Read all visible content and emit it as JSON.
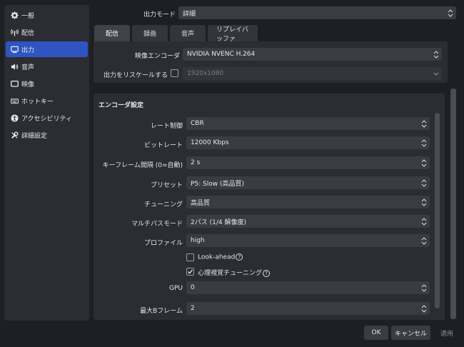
{
  "sidebar": {
    "items": [
      {
        "label": "一般",
        "icon": "gear-icon"
      },
      {
        "label": "配信",
        "icon": "antenna-icon"
      },
      {
        "label": "出力",
        "icon": "monitor-output-icon",
        "active": true
      },
      {
        "label": "音声",
        "icon": "speaker-icon"
      },
      {
        "label": "映像",
        "icon": "display-icon"
      },
      {
        "label": "ホットキー",
        "icon": "keyboard-icon"
      },
      {
        "label": "アクセシビリティ",
        "icon": "accessibility-icon"
      },
      {
        "label": "詳細設定",
        "icon": "wrench-icon"
      }
    ]
  },
  "output_mode": {
    "label": "出力モード",
    "value": "詳細"
  },
  "tabs": [
    "配信",
    "録画",
    "音声",
    "リプレイバッファ"
  ],
  "encoder": {
    "label": "映像エンコーダ",
    "value": "NVIDIA NVENC H.264"
  },
  "rescale": {
    "label": "出力をリスケールする",
    "value": "1920x1080"
  },
  "encoder_settings": {
    "title": "エンコーダ設定",
    "rate_control": {
      "label": "レート制御",
      "value": "CBR"
    },
    "bitrate": {
      "label": "ビットレート",
      "value": "12000 Kbps"
    },
    "keyframe": {
      "label": "キーフレーム間隔 (0=自動)",
      "value": "2 s"
    },
    "preset": {
      "label": "プリセット",
      "value": "P5: Slow (高品質)"
    },
    "tuning": {
      "label": "チューニング",
      "value": "高品質"
    },
    "multipass": {
      "label": "マルチパスモード",
      "value": "2パス (1/4 解像度)"
    },
    "profile": {
      "label": "プロファイル",
      "value": "high"
    },
    "lookahead": {
      "label": "Look-ahead",
      "checked": false
    },
    "psycho": {
      "label": "心理視覚チューニング",
      "checked": true
    },
    "gpu": {
      "label": "GPU",
      "value": "0"
    },
    "bframes": {
      "label": "最大Bフレーム",
      "value": "2"
    }
  },
  "buttons": {
    "ok": "OK",
    "cancel": "キャンセル",
    "apply": "適用"
  },
  "colors": {
    "accent": "#2f55c2",
    "panel": "#2b2d33",
    "background": "#1e1f24"
  }
}
